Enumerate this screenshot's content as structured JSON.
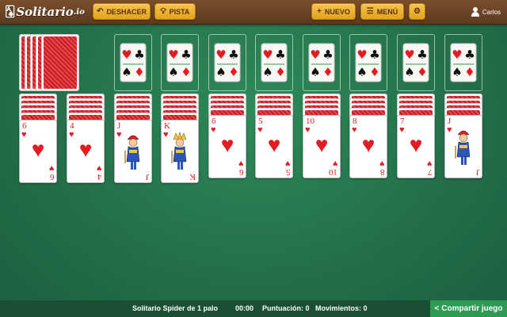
{
  "app": {
    "logo_text": "Solitario",
    "logo_suffix": ".io"
  },
  "toolbar": {
    "undo_label": "DESHACER",
    "hint_label": "PISTA",
    "new_label": "NUEVO",
    "menu_label": "MENÚ"
  },
  "user": {
    "name": "Carlos"
  },
  "colors": {
    "felt": "#23704a",
    "button": "#f2b632",
    "card_red": "#e31c24",
    "share": "#2f9a54"
  },
  "stock": {
    "piles": 5
  },
  "foundations": {
    "slots": 8,
    "icon": "four-suits-icon"
  },
  "tableau": [
    {
      "hidden": 5,
      "card": {
        "rank": "6",
        "suit": "♥",
        "face": "pip"
      }
    },
    {
      "hidden": 5,
      "card": {
        "rank": "4",
        "suit": "♥",
        "face": "pip"
      }
    },
    {
      "hidden": 5,
      "card": {
        "rank": "J",
        "suit": "♥",
        "face": "court"
      }
    },
    {
      "hidden": 5,
      "card": {
        "rank": "K",
        "suit": "♥",
        "face": "court"
      }
    },
    {
      "hidden": 4,
      "card": {
        "rank": "6",
        "suit": "♥",
        "face": "pip"
      }
    },
    {
      "hidden": 4,
      "card": {
        "rank": "5",
        "suit": "♥",
        "face": "pip"
      }
    },
    {
      "hidden": 4,
      "card": {
        "rank": "10",
        "suit": "♥",
        "face": "pip"
      }
    },
    {
      "hidden": 4,
      "card": {
        "rank": "8",
        "suit": "♥",
        "face": "pip"
      }
    },
    {
      "hidden": 4,
      "card": {
        "rank": "7",
        "suit": "♥",
        "face": "pip"
      }
    },
    {
      "hidden": 4,
      "card": {
        "rank": "J",
        "suit": "♥",
        "face": "court"
      }
    }
  ],
  "status": {
    "game_name": "Solitario Spider de 1 palo",
    "time": "00:00",
    "score_label": "Puntuación: 0",
    "moves_label": "Movimientos: 0"
  },
  "share": {
    "label": "Compartir juego"
  }
}
